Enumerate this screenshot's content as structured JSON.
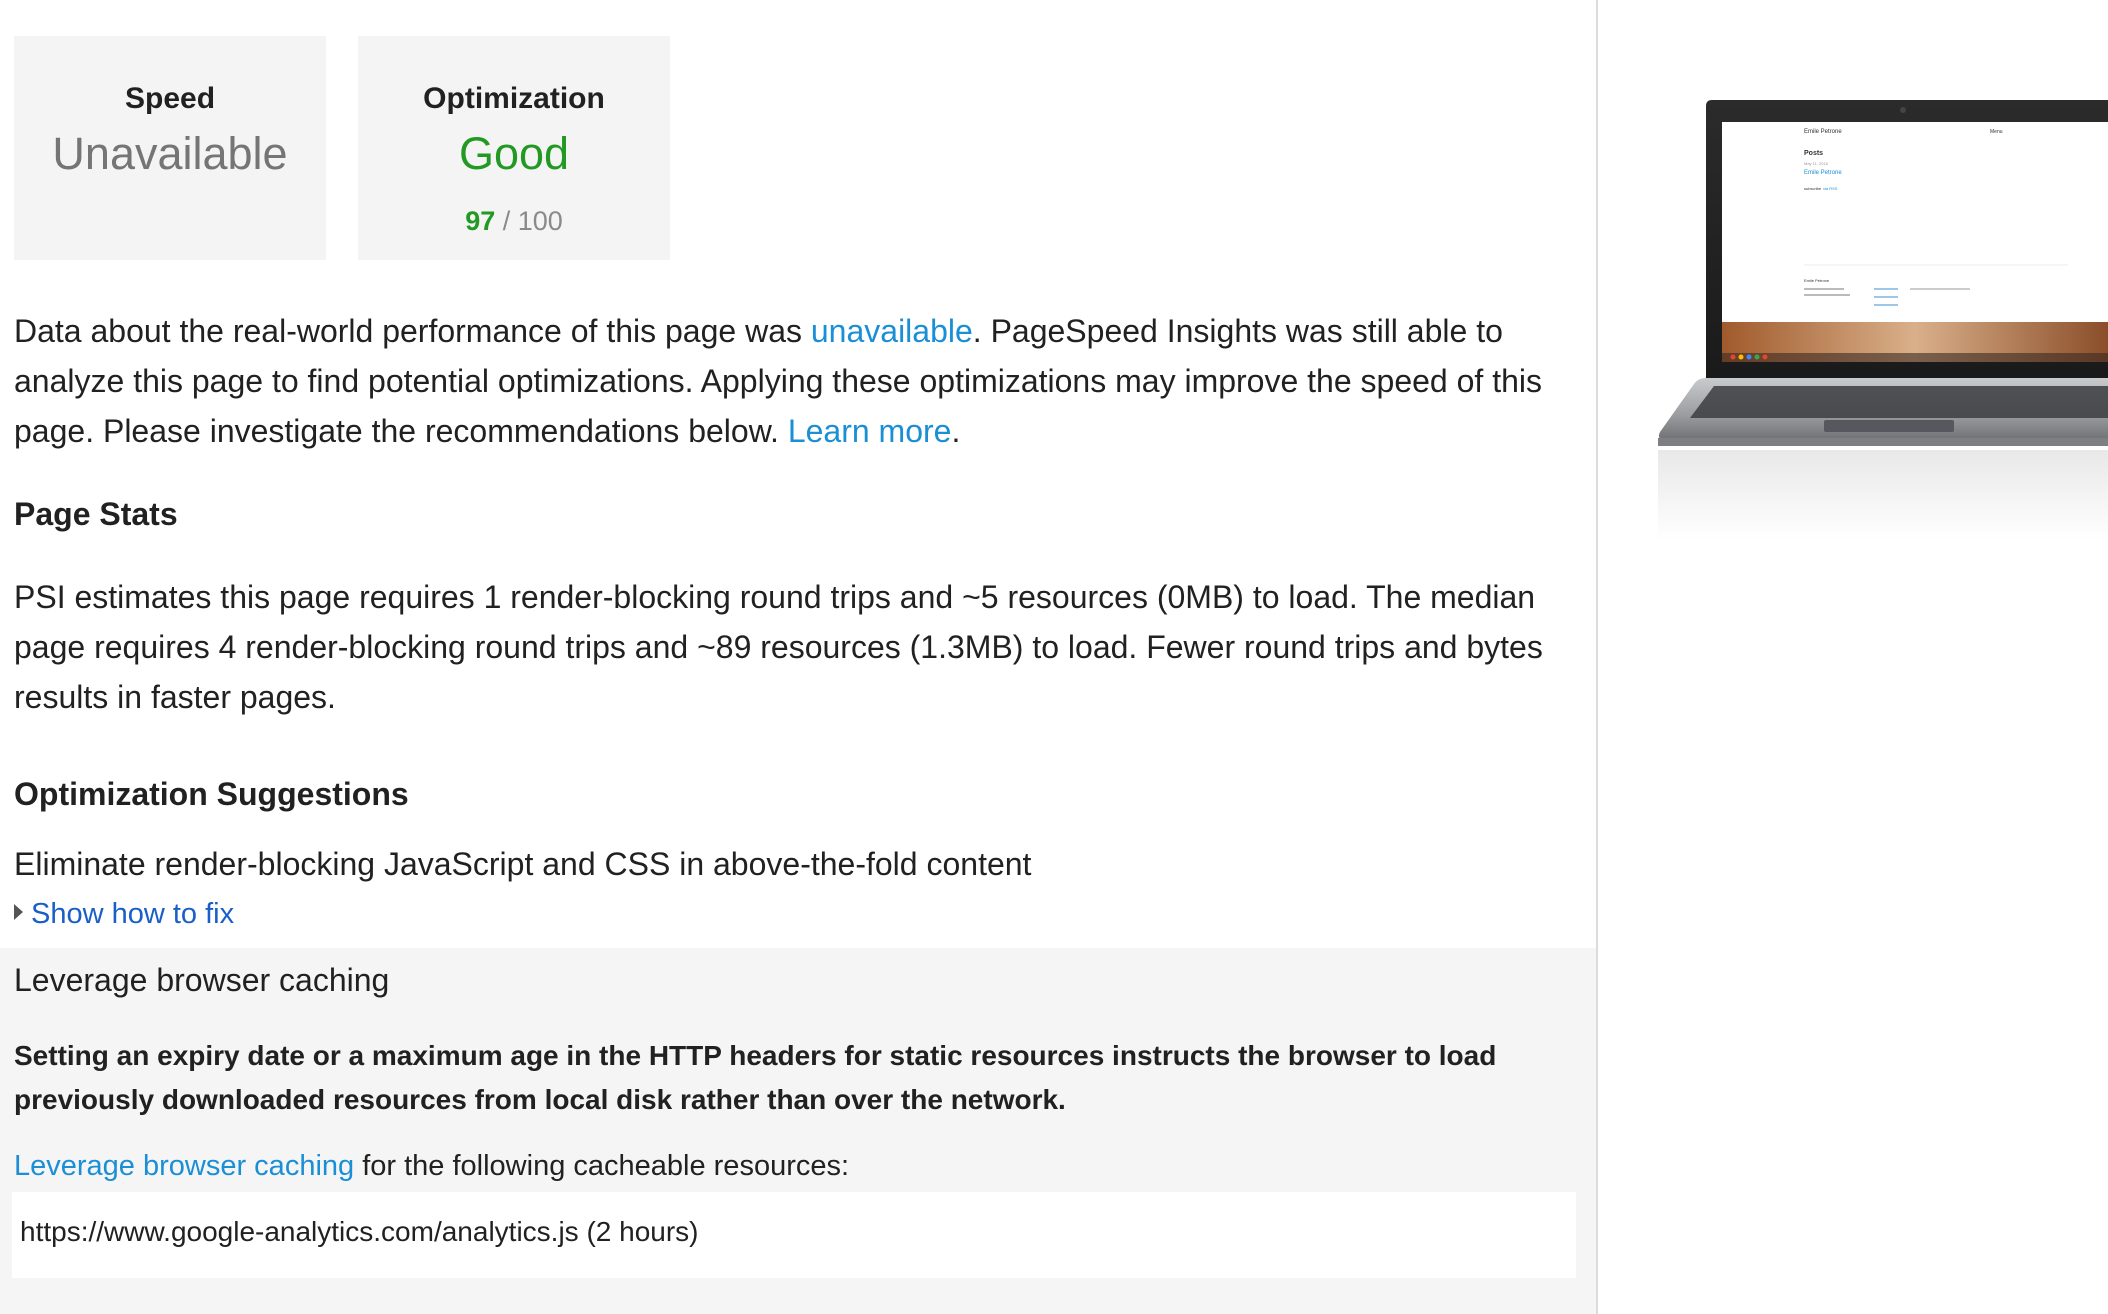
{
  "scores": {
    "speed": {
      "label": "Speed",
      "value": "Unavailable"
    },
    "optimization": {
      "label": "Optimization",
      "value": "Good",
      "score": "97",
      "max": "/ 100"
    }
  },
  "intro": {
    "text1": "Data about the real-world performance of this page was ",
    "link1": "unavailable",
    "text2": ". PageSpeed Insights was still able to analyze this page to find potential optimizations. Applying these optimizations may improve the speed of this page. Please investigate the recommendations below. ",
    "link2": "Learn more",
    "text3": "."
  },
  "page_stats": {
    "heading": "Page Stats",
    "text": "PSI estimates this page requires 1 render-blocking round trips and ~5 resources (0MB) to load. The median page requires 4 render-blocking round trips and ~89 resources (1.3MB) to load. Fewer round trips and bytes results in faster pages."
  },
  "suggestions": {
    "heading": "Optimization Suggestions",
    "rule1": {
      "title": "Eliminate render-blocking JavaScript and CSS in above-the-fold content",
      "show_fix": "Show how to fix"
    },
    "rule2": {
      "title": "Leverage browser caching",
      "description": "Setting an expiry date or a maximum age in the HTTP headers for static resources instructs the browser to load previously downloaded resources from local disk rather than over the network.",
      "link": "Leverage browser caching",
      "follow_text": " for the following cacheable resources:",
      "resources": [
        "https://www.google-analytics.com/analytics.js (2 hours)"
      ]
    }
  },
  "preview": {
    "site_title": "Emile Petrone",
    "menu": "Menu",
    "posts_heading": "Posts",
    "post_date": "May 11, 2016",
    "post_title": "Emile Petrone",
    "subscribe": "subscribe",
    "rss": "via RSS",
    "footer_title": "Emile Petrone"
  },
  "colors": {
    "link": "#1a8fd6",
    "good": "#229922",
    "muted": "#8a8a8a"
  }
}
